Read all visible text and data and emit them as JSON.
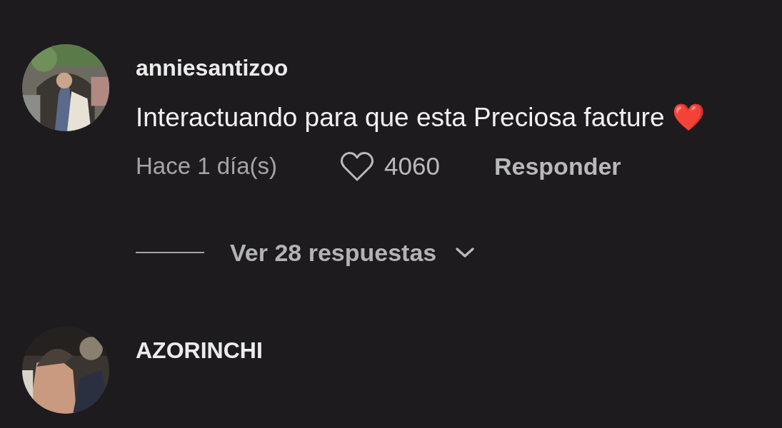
{
  "comments": [
    {
      "username": "anniesantizoo",
      "text": "Interactuando para que esta Preciosa facture ❤️",
      "time": "Hace 1 día(s)",
      "likes": "4060",
      "liked": false,
      "reply": "Responder",
      "view_replies": "Ver 28 respuestas"
    },
    {
      "username": "AZORINCHI"
    }
  ]
}
